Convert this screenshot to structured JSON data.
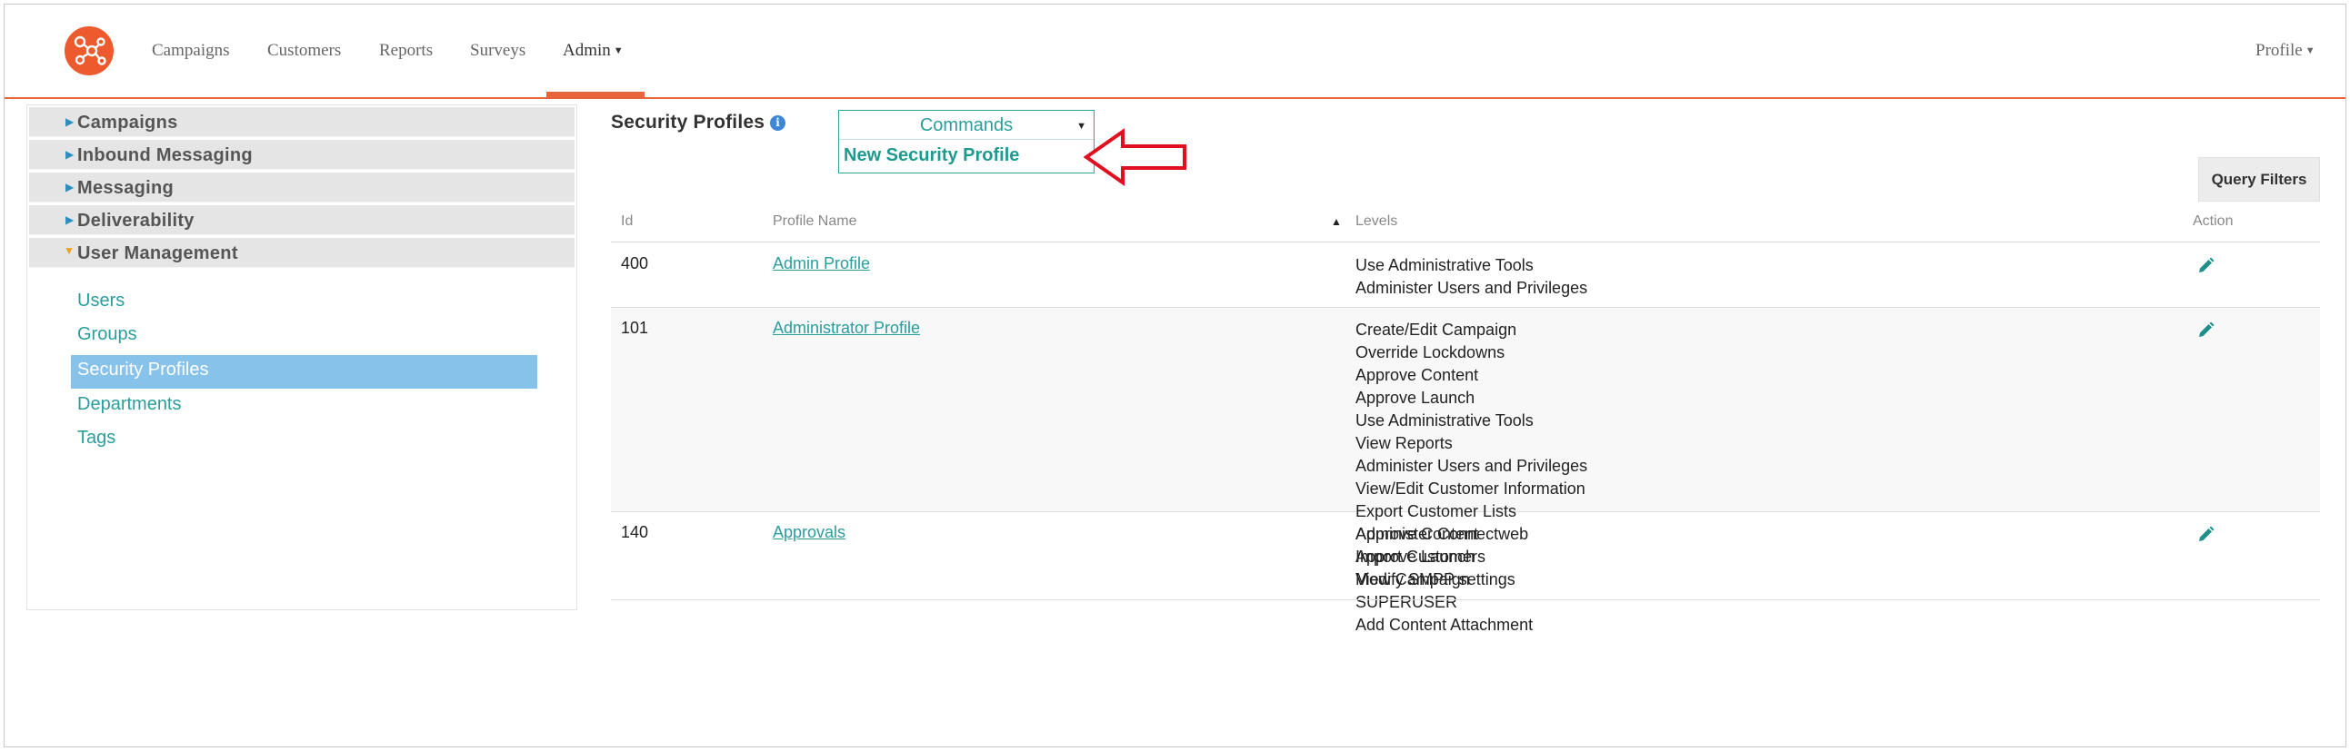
{
  "nav": {
    "items": [
      "Campaigns",
      "Customers",
      "Reports",
      "Surveys"
    ],
    "admin_label": "Admin",
    "profile_label": "Profile"
  },
  "sidebar": {
    "sections": [
      {
        "label": "Campaigns",
        "expanded": false
      },
      {
        "label": "Inbound Messaging",
        "expanded": false
      },
      {
        "label": "Messaging",
        "expanded": false
      },
      {
        "label": "Deliverability",
        "expanded": false
      },
      {
        "label": "User Management",
        "expanded": true
      }
    ],
    "sub_items": [
      "Users",
      "Groups",
      "Security Profiles",
      "Departments",
      "Tags"
    ],
    "active_sub_item": "Security Profiles"
  },
  "main": {
    "title": "Security Profiles",
    "info_glyph": "i",
    "commands": {
      "label": "Commands",
      "options": [
        "New Security Profile"
      ]
    },
    "query_filters_label": "Query Filters"
  },
  "table": {
    "headers": [
      "Id",
      "Profile Name",
      "Levels",
      "Action"
    ],
    "rows": [
      {
        "id": "400",
        "name": "Admin Profile",
        "levels": [
          "Use Administrative Tools",
          "Administer Users and Privileges"
        ]
      },
      {
        "id": "101",
        "name": "Administrator Profile",
        "levels": [
          "Create/Edit Campaign",
          "Override Lockdowns",
          "Approve Content",
          "Approve Launch",
          "Use Administrative Tools",
          "View Reports",
          "Administer Users and Privileges",
          "View/Edit Customer Information",
          "Export Customer Lists",
          "Administer Connectweb",
          "Import Customers",
          "Modify SMPP settings",
          "SUPERUSER",
          "Add Content Attachment"
        ]
      },
      {
        "id": "140",
        "name": "Approvals",
        "levels": [
          "Approve Content",
          "Approve Launch",
          "View Campaign"
        ]
      }
    ]
  },
  "colors": {
    "brand": "#ec5a2d",
    "accent_teal": "#2a9d9d",
    "active_sidebar": "#86c2ea",
    "annotation_arrow": "#e0101e"
  },
  "icons": {
    "logo": "network-logo-icon",
    "info": "info-icon",
    "edit": "pencil-icon",
    "expand": "triangle-right-icon",
    "collapse": "triangle-down-icon"
  }
}
